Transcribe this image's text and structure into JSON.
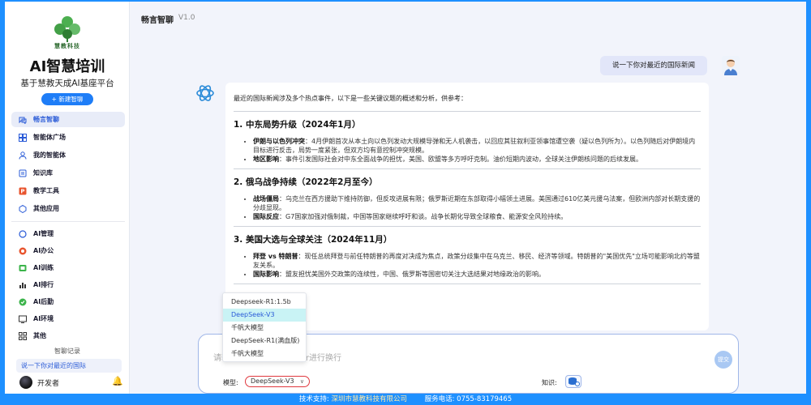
{
  "sidebar": {
    "logo_text": "慧教科技",
    "brand": "AI智慧培训",
    "tagline": "基于慧教天成AI基座平台",
    "new_chat": "+ 新建智聊",
    "items_top": [
      {
        "label": "畅言智聊",
        "icon": "chat-icon"
      },
      {
        "label": "智能体广场",
        "icon": "grid-icon"
      },
      {
        "label": "我的智能体",
        "icon": "user-agent-icon"
      },
      {
        "label": "知识库",
        "icon": "book-icon"
      },
      {
        "label": "教学工具",
        "icon": "ppt-icon"
      },
      {
        "label": "其他应用",
        "icon": "apps-icon"
      }
    ],
    "items_bottom": [
      {
        "label": "AI管理",
        "icon": "circle-icon"
      },
      {
        "label": "AI办公",
        "icon": "office-icon"
      },
      {
        "label": "AI训练",
        "icon": "train-icon"
      },
      {
        "label": "AI排行",
        "icon": "rank-icon"
      },
      {
        "label": "AI后勤",
        "icon": "logistics-icon"
      },
      {
        "label": "AI环境",
        "icon": "env-icon"
      },
      {
        "label": "其他",
        "icon": "other-icon"
      }
    ],
    "history_title": "智聊记录",
    "history_item": "说一下你对最近的国际",
    "user_name": "开发者"
  },
  "header": {
    "title": "畅言智聊",
    "version": "V1.0"
  },
  "chat": {
    "user_message": "说一下你对最近的国际新闻",
    "intro": "最近的国际新闻涉及多个热点事件，以下是一些关键议题的概述和分析，供参考：",
    "sections": [
      {
        "heading": "1. 中东局势升级（2024年1月）",
        "points": [
          {
            "title": "伊朗与以色列冲突",
            "text": "：4月伊朗首次从本土向以色列发动大规模导弹和无人机袭击，以回应其驻叙利亚领事馆遭空袭（疑以色列所为）。以色列随后对伊朗境内目标进行反击，局势一度紧张，但双方均有意控制冲突规模。"
          },
          {
            "title": "地区影响",
            "text": "：事件引发国际社会对中东全面战争的担忧，美国、欧盟等多方呼吁克制。油价短期内波动，全球关注伊朗核问题的后续发展。"
          }
        ]
      },
      {
        "heading": "2. 俄乌战争持续（2022年2月至今）",
        "points": [
          {
            "title": "战场僵局",
            "text": "：乌克兰在西方援助下维持防御，但反攻进展有限；俄罗斯近期在东部取得小幅领土进展。美国通过610亿美元援乌法案，但欧洲内部对长期支援的分歧显现。"
          },
          {
            "title": "国际反应",
            "text": "：G7国家加强对俄制裁，中国等国家继续呼吁和谈。战争长期化导致全球粮食、能源安全风险持续。"
          }
        ]
      },
      {
        "heading": "3. 美国大选与全球关注（2024年11月）",
        "points": [
          {
            "title": "拜登 vs 特朗普",
            "text": "：现任总统拜登与前任特朗普的再度对决成为焦点，政策分歧集中在乌克兰、移民、经济等领域。特朗普的\"美国优先\"立场可能影响北约等盟友关系。"
          },
          {
            "title": "国际影响",
            "text": "：盟友担忧美国外交政策的连续性，中国、俄罗斯等国密切关注大选结果对地缘政治的影响。"
          }
        ]
      }
    ]
  },
  "input": {
    "placeholder": "请输入问题，Shift+Enter进行换行",
    "submit_label": "提交",
    "model_label": "模型:",
    "model_value": "DeepSeek-V3",
    "kb_label": "知识:"
  },
  "model_dropdown": {
    "options": [
      "Deepseek-R1:1.5b",
      "DeepSeek-V3",
      "千帆大模型",
      "DeepSeek-R1(满血版)",
      "千帆大模型"
    ],
    "selected_index": 1
  },
  "footer": {
    "support_label": "技术支持:",
    "support_company": "深圳市慧教科技有限公司",
    "phone_label": "服务电话:",
    "phone": "0755-83179465"
  },
  "colors": {
    "accent": "#1e90ff",
    "active_nav": "#2a5bd7",
    "brand_green": "#3a9a3c"
  }
}
